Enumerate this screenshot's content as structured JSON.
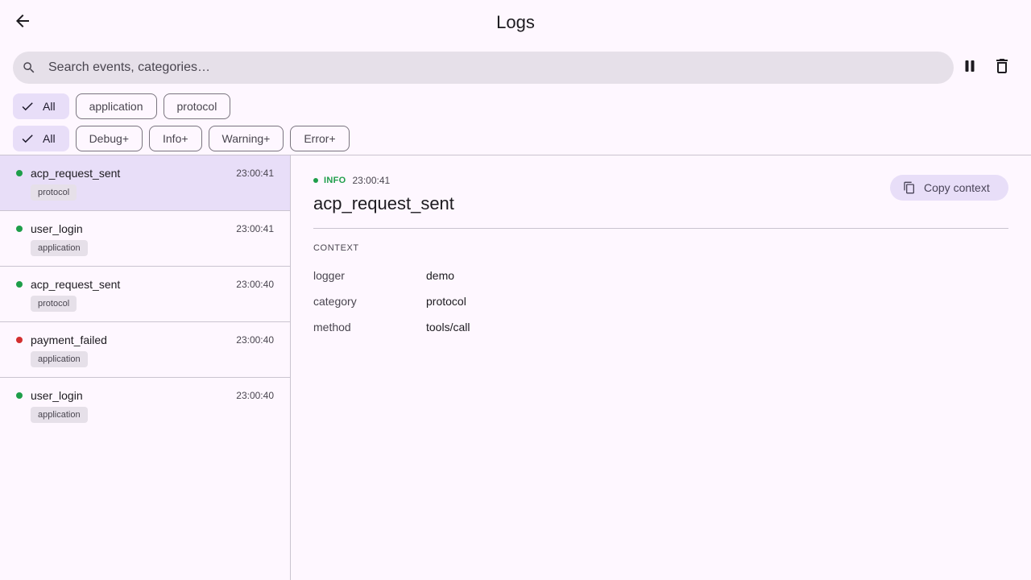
{
  "appbar": {
    "title": "Logs",
    "back_icon": "arrow-back-icon"
  },
  "search": {
    "placeholder": "Search events, categories…",
    "value": ""
  },
  "actions": {
    "pause_icon": "pause-icon",
    "clear_icon": "delete-icon"
  },
  "category_filters": [
    {
      "label": "All",
      "selected": true
    },
    {
      "label": "application",
      "selected": false
    },
    {
      "label": "protocol",
      "selected": false
    }
  ],
  "level_filters": [
    {
      "label": "All",
      "selected": true
    },
    {
      "label": "Debug+",
      "selected": false
    },
    {
      "label": "Info+",
      "selected": false
    },
    {
      "label": "Warning+",
      "selected": false
    },
    {
      "label": "Error+",
      "selected": false
    }
  ],
  "events": [
    {
      "name": "acp_request_sent",
      "time": "23:00:41",
      "category": "protocol",
      "status_color": "#1e9e4a",
      "active": true
    },
    {
      "name": "user_login",
      "time": "23:00:41",
      "category": "application",
      "status_color": "#1e9e4a",
      "active": false
    },
    {
      "name": "acp_request_sent",
      "time": "23:00:40",
      "category": "protocol",
      "status_color": "#1e9e4a",
      "active": false
    },
    {
      "name": "payment_failed",
      "time": "23:00:40",
      "category": "application",
      "status_color": "#d32f2f",
      "active": false
    },
    {
      "name": "user_login",
      "time": "23:00:40",
      "category": "application",
      "status_color": "#1e9e4a",
      "active": false
    }
  ],
  "detail": {
    "level": "INFO",
    "time": "23:00:41",
    "title": "acp_request_sent",
    "copy_label": "Copy context",
    "context_label": "CONTEXT",
    "context": [
      {
        "key": "logger",
        "value": "demo"
      },
      {
        "key": "category",
        "value": "protocol"
      },
      {
        "key": "method",
        "value": "tools/call"
      }
    ]
  },
  "colors": {
    "accent": "#e8def8",
    "info": "#1e9e4a",
    "error": "#d32f2f",
    "background": "#fef7ff"
  }
}
